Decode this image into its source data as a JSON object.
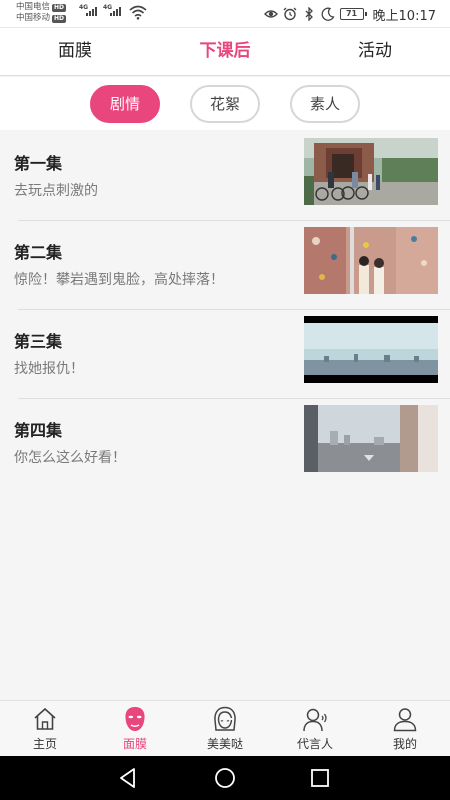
{
  "status_bar": {
    "carrier_1": "中国电信",
    "carrier_2": "中国移动",
    "hd_1": "HD",
    "hd_2": "HD",
    "network_1": "4G",
    "network_2": "4G",
    "battery": "71",
    "time": "晚上10:17",
    "icons": [
      "eye-icon",
      "alarm-icon",
      "bluetooth-icon",
      "moon-icon",
      "battery-icon",
      "wifi-icon",
      "signal-icon"
    ]
  },
  "top_tabs": [
    {
      "label": "面膜",
      "active": false
    },
    {
      "label": "下课后",
      "active": true
    },
    {
      "label": "活动",
      "active": false
    }
  ],
  "filters": [
    {
      "label": "剧情",
      "active": true
    },
    {
      "label": "花絮",
      "active": false
    },
    {
      "label": "素人",
      "active": false
    }
  ],
  "episodes": [
    {
      "title": "第一集",
      "desc": "去玩点刺激的"
    },
    {
      "title": "第二集",
      "desc": "惊险！攀岩遇到鬼脸，高处摔落！"
    },
    {
      "title": "第三集",
      "desc": "找她报仇！"
    },
    {
      "title": "第四集",
      "desc": "你怎么这么好看！"
    }
  ],
  "bottom_nav": [
    {
      "label": "主页",
      "icon": "home-icon",
      "active": false
    },
    {
      "label": "面膜",
      "icon": "face-mask-icon",
      "active": true
    },
    {
      "label": "美美哒",
      "icon": "girl-face-icon",
      "active": false
    },
    {
      "label": "代言人",
      "icon": "spokesperson-icon",
      "active": false
    },
    {
      "label": "我的",
      "icon": "user-icon",
      "active": false
    }
  ],
  "colors": {
    "accent": "#e8467c",
    "text": "#222222",
    "subtext": "#7a7a7a",
    "background": "#f5f5f5"
  }
}
